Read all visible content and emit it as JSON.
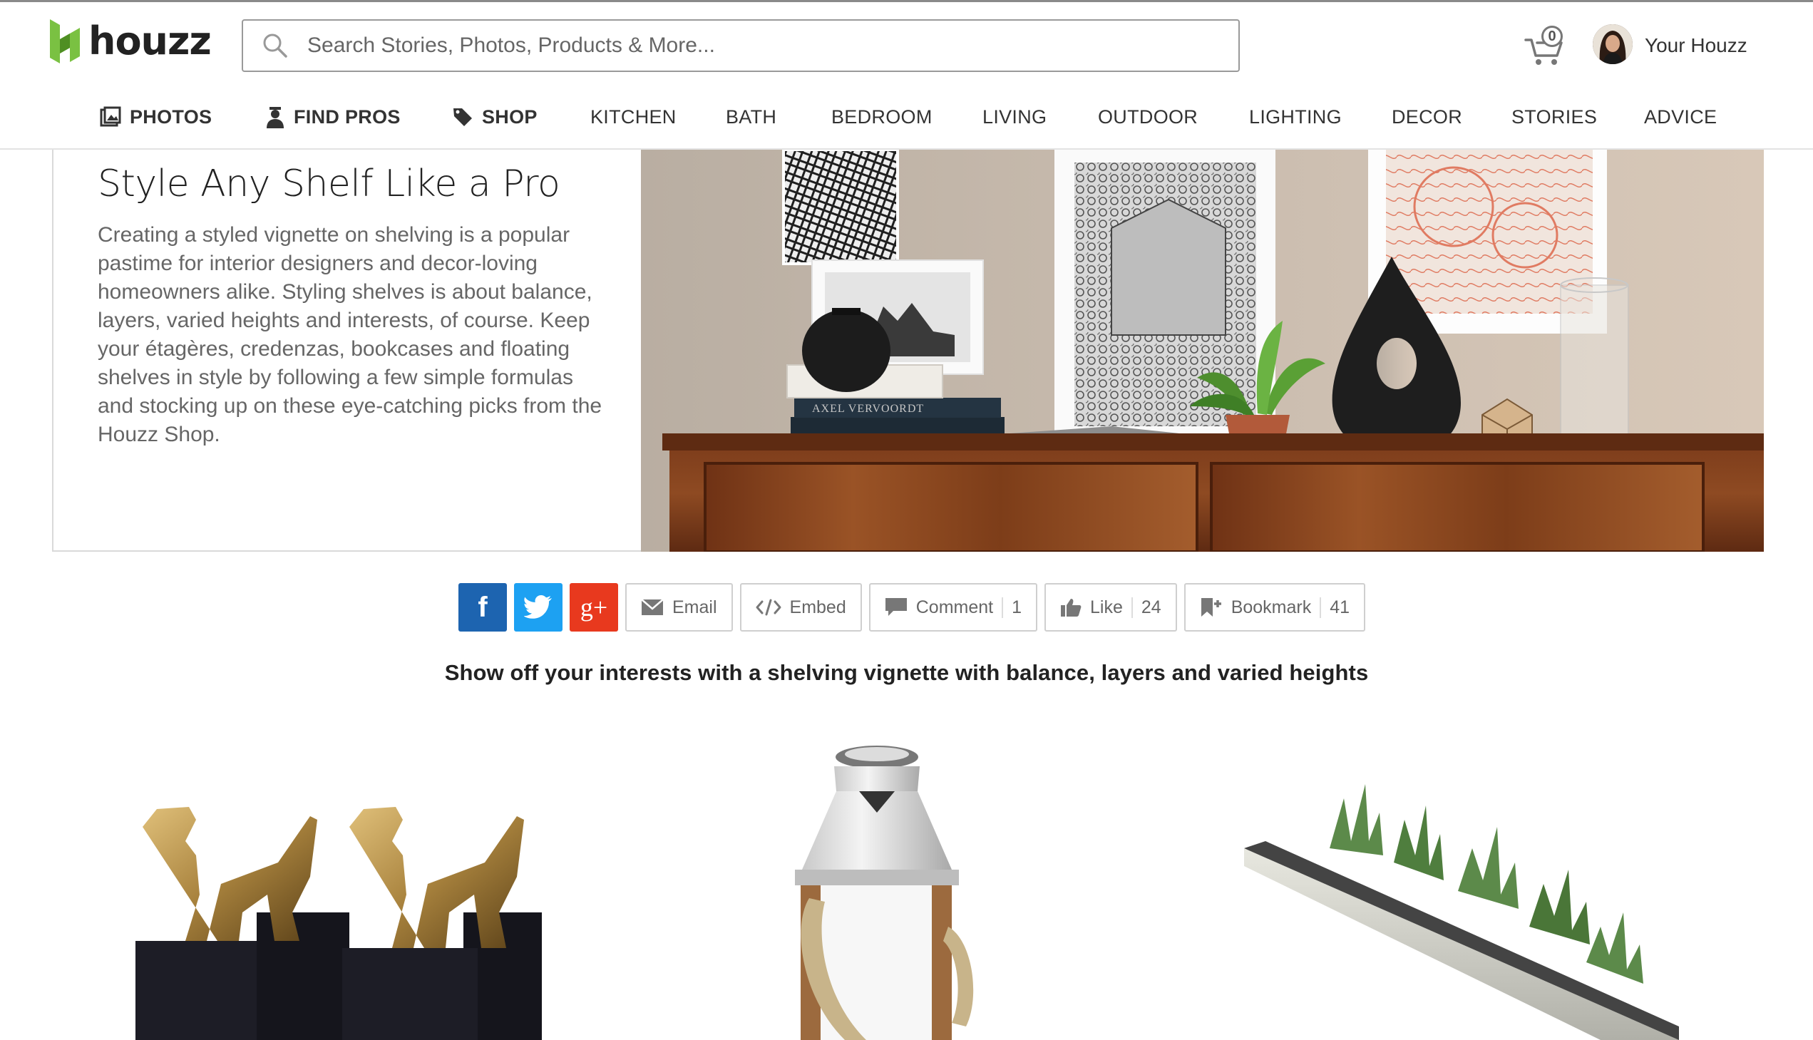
{
  "header": {
    "logo_text": "houzz",
    "search_placeholder": "Search Stories, Photos, Products & More...",
    "cart_count": "0",
    "user_label": "Your Houzz"
  },
  "nav": [
    {
      "label": "PHOTOS",
      "icon": "photos-icon"
    },
    {
      "label": "FIND PROS",
      "icon": "person-icon"
    },
    {
      "label": "SHOP",
      "icon": "tag-icon"
    },
    {
      "label": "KITCHEN"
    },
    {
      "label": "BATH"
    },
    {
      "label": "BEDROOM"
    },
    {
      "label": "LIVING"
    },
    {
      "label": "OUTDOOR"
    },
    {
      "label": "LIGHTING"
    },
    {
      "label": "DECOR"
    },
    {
      "label": "STORIES"
    },
    {
      "label": "ADVICE"
    }
  ],
  "hero": {
    "title": "Style Any Shelf Like a Pro",
    "description": "Creating a styled vignette on shelving is a popular pastime for interior designers and decor-loving homeowners alike. Styling shelves is about balance, layers, varied heights and interests, of course. Keep your étagères, credenzas, bookcases and floating shelves in style by following a few simple formulas and stocking up on these eye-catching picks from the Houzz Shop.",
    "book_spine_text": "AXEL VERVOORDT"
  },
  "share": {
    "facebook": "f",
    "google_plus": "g+",
    "email_label": "Email",
    "embed_label": "Embed",
    "comment_label": "Comment",
    "comment_count": "1",
    "like_label": "Like",
    "like_count": "24",
    "bookmark_label": "Bookmark",
    "bookmark_count": "41"
  },
  "subtitle": "Show off your interests with a shelving vignette with balance, layers and varied heights",
  "colors": {
    "brand_green": "#7ac142",
    "facebook": "#1d64b0",
    "twitter": "#1da1f2",
    "google": "#e8391e"
  }
}
